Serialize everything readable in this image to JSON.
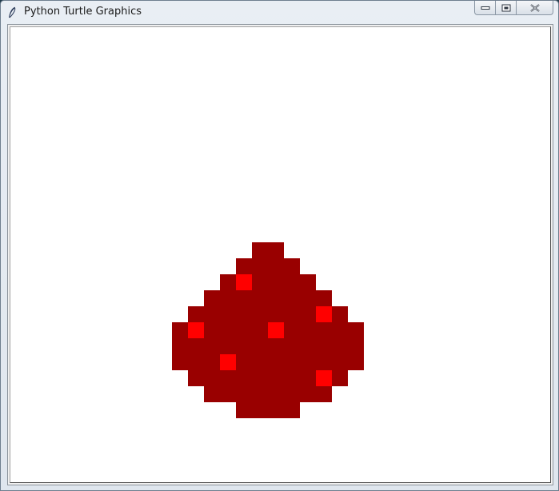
{
  "window": {
    "title": "Python Turtle Graphics",
    "app_icon": "feather-icon",
    "controls": [
      "minimize-icon",
      "restore-icon",
      "close-icon"
    ]
  },
  "canvas": {
    "background": "#ffffff",
    "drawing": {
      "description_colors": {
        "body": "#990000",
        "dot": "#ff0000"
      }
    }
  }
}
